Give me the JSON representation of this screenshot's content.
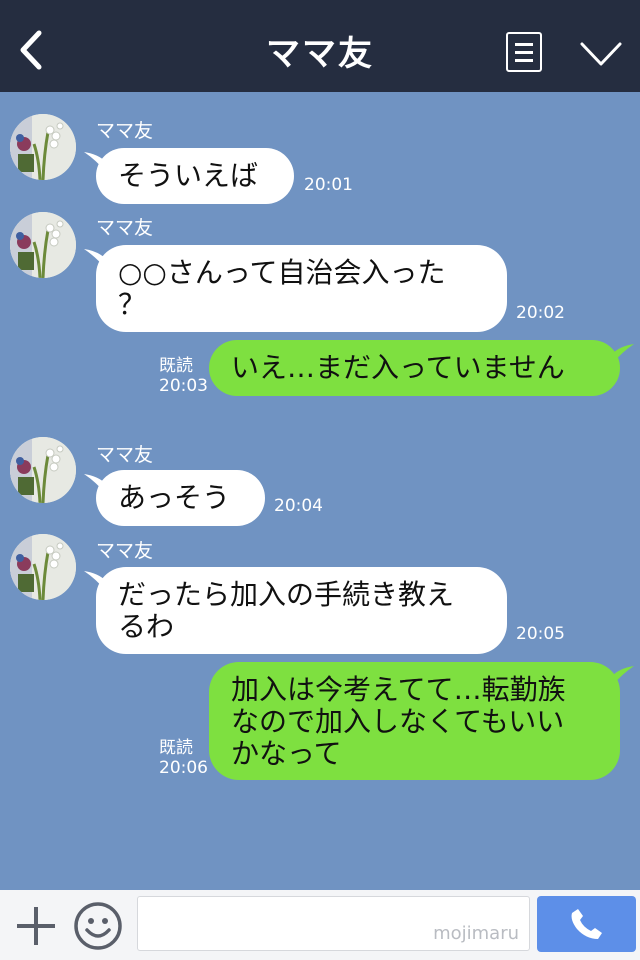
{
  "header": {
    "title": "ママ友",
    "back_icon": "chevron-left-icon",
    "menu_icon": "list-icon",
    "collapse_icon": "chevron-down-icon"
  },
  "messages": [
    {
      "direction": "in",
      "sender": "ママ友",
      "lines": [
        "そういえば"
      ],
      "time": "20:01"
    },
    {
      "direction": "in",
      "sender": "ママ友",
      "lines": [
        "○○さんって自治会入った",
        "？"
      ],
      "time": "20:02"
    },
    {
      "direction": "out",
      "lines": [
        "いえ…まだ入っていません"
      ],
      "read": "既読",
      "time": "20:03"
    },
    {
      "direction": "in",
      "sender": "ママ友",
      "lines": [
        "あっそう"
      ],
      "time": "20:04"
    },
    {
      "direction": "in",
      "sender": "ママ友",
      "lines": [
        "だったら加入の手続き教え",
        "るわ"
      ],
      "time": "20:05"
    },
    {
      "direction": "out",
      "lines": [
        "加入は今考えてて…転勤族",
        "なので加入しなくてもいい",
        "かなって"
      ],
      "read": "既読",
      "time": "20:06"
    }
  ],
  "footer": {
    "plus_icon": "plus-icon",
    "emoji_icon": "smiley-icon",
    "input_value": "",
    "watermark": "mojimaru",
    "call_icon": "phone-icon"
  },
  "colors": {
    "header_bg": "#252d40",
    "chat_bg": "#7093c2",
    "incoming_bubble": "#ffffff",
    "outgoing_bubble": "#7ee040",
    "call_button": "#5d8fe8"
  }
}
